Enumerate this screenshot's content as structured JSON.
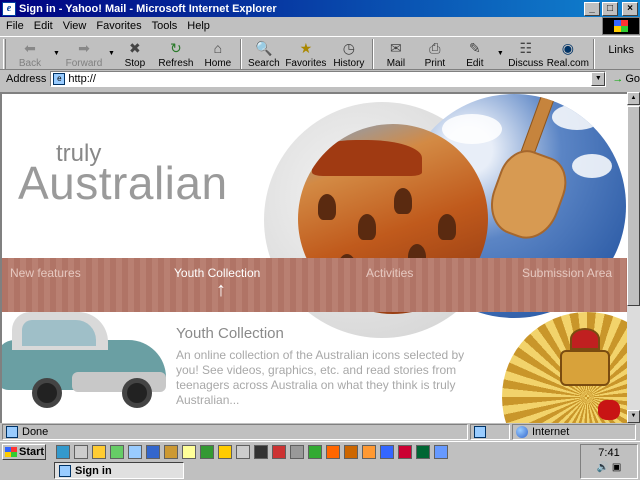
{
  "window": {
    "title": "Sign in - Yahoo! Mail - Microsoft Internet Explorer",
    "icon": "ie-icon",
    "minimize": "_",
    "maximize": "□",
    "close": "×"
  },
  "menu": [
    {
      "label": "File"
    },
    {
      "label": "Edit"
    },
    {
      "label": "View"
    },
    {
      "label": "Favorites"
    },
    {
      "label": "Tools"
    },
    {
      "label": "Help"
    }
  ],
  "toolbar": {
    "back": "Back",
    "forward": "Forward",
    "stop": "Stop",
    "refresh": "Refresh",
    "home": "Home",
    "search": "Search",
    "favorites": "Favorites",
    "history": "History",
    "mail": "Mail",
    "print": "Print",
    "edit": "Edit",
    "discuss": "Discuss",
    "realcom": "Real.com",
    "links": "Links"
  },
  "address": {
    "label": "Address",
    "value": "http://",
    "go": "Go"
  },
  "page": {
    "hero_sub": "truly",
    "hero_main": "Australian",
    "nav": [
      {
        "label": "New features"
      },
      {
        "label": "Youth Collection"
      },
      {
        "label": "Activities"
      },
      {
        "label": "Submission Area"
      }
    ],
    "nav_active_arrow": "↑",
    "section_title": "Youth Collection",
    "section_desc": "An online collection of the Australian icons selected by you! See videos, graphics, etc. and read stories from teenagers across Australia on what they think is truly Australian..."
  },
  "status": {
    "text": "Done",
    "zone": "Internet"
  },
  "taskbar": {
    "start": "Start",
    "task": "Sign in",
    "clock": "7:41"
  },
  "colors": {
    "titlebar": "#000080",
    "nav_band": "#b07466",
    "text_gray": "#9a9a9a"
  }
}
